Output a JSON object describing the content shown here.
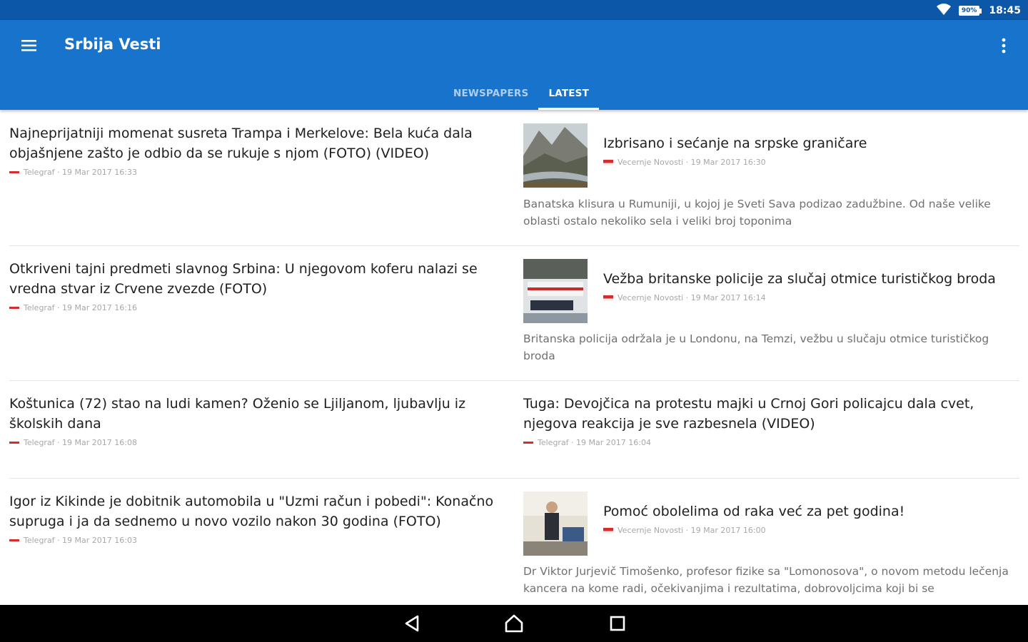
{
  "status_bar": {
    "battery": "90%",
    "time": "18:45"
  },
  "app": {
    "title": "Srbija Vesti"
  },
  "tabs": [
    {
      "label": "NEWSPAPERS",
      "active": false
    },
    {
      "label": "LATEST",
      "active": true
    }
  ],
  "articles_left": [
    {
      "headline": "Najneprijatniji momenat susreta Trampa i Merkelove: Bela kuća dala objašnjene zašto je odbio da se rukuje s njom (FOTO) (VIDEO)",
      "meta": "Telegraf · 19 Mar 2017 16:33"
    },
    {
      "headline": "Otkriveni tajni predmeti slavnog Srbina: U njegovom koferu nalazi se vredna stvar iz Crvene zvezde (FOTO)",
      "meta": "Telegraf · 19 Mar 2017 16:16"
    },
    {
      "headline": "Koštunica (72) stao na ludi kamen? Oženio se Ljiljanom, ljubavlju iz školskih dana",
      "meta": "Telegraf · 19 Mar 2017 16:08"
    },
    {
      "headline": "Igor iz Kikinde je dobitnik automobila u \"Uzmi račun i pobedi\": Konačno supruga i ja da sednemo u novo vozilo nakon 30 godina (FOTO)",
      "meta": "Telegraf · 19 Mar 2017 16:03"
    }
  ],
  "articles_right": [
    {
      "headline": "Izbrisano i sećanje na srpske graničare",
      "meta": "Vecernje Novosti · 19 Mar 2017 16:30",
      "summary": "Banatska klisura u Rumuniji, u kojoj je Sveti Sava podizao zadužbine. Od naše velike oblasti ostalo nekoliko sela i veliki broj toponima",
      "thumb": "river-valley"
    },
    {
      "headline": "Vežba britanske policije za slučaj otmice turističkog broda",
      "meta": "Vecernje Novosti · 19 Mar 2017 16:14",
      "summary": "Britanska policija održala je u Londonu, na Temzi, vežbu u slučaju otmice turističkog broda",
      "thumb": "police-boat"
    },
    {
      "headline": "Tuga: Devojčica na protestu majki u Crnoj Gori policajcu dala cvet, njegova reakcija je sve razbesnela (VIDEO)",
      "meta": "Telegraf · 19 Mar 2017 16:04"
    },
    {
      "headline": "Pomoć obolelima od raka već za pet godina!",
      "meta": "Vecernje Novosti · 19 Mar 2017 16:00",
      "summary": "Dr Viktor Jurjevič Timošenko, profesor fizike sa \"Lomonosova\", o novom metodu lečenja kancera na kome radi, očekivanjima i rezultatima, dobrovoljcima koji bi se",
      "thumb": "professor-lab"
    }
  ],
  "colors": {
    "status_bar": "#0d57a8",
    "app_bar": "#1873cd",
    "nav_bar": "#000000",
    "flag_red": "#d62c2c"
  },
  "icons": [
    "wifi-icon",
    "battery-icon",
    "menu-icon",
    "more-vert-icon",
    "back-icon",
    "home-icon",
    "recents-icon"
  ]
}
